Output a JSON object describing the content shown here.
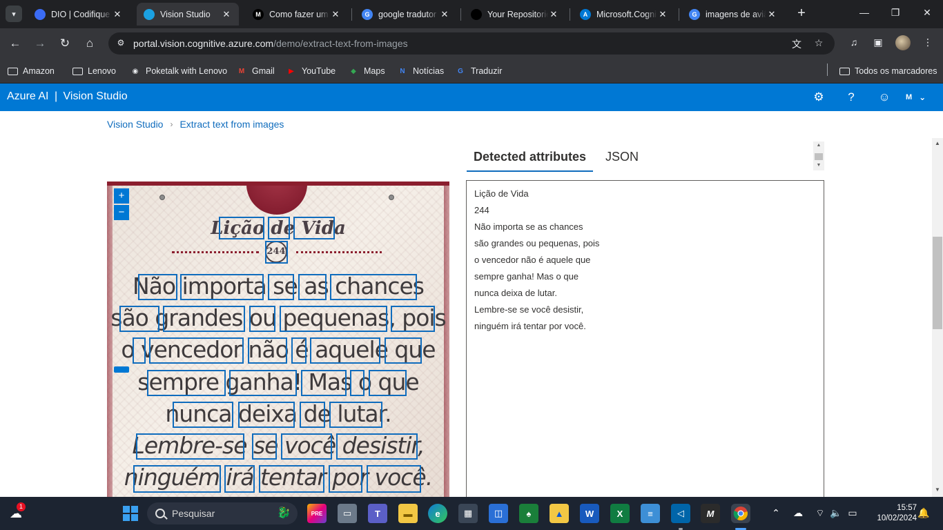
{
  "browser": {
    "tabs": [
      {
        "title": "DIO | Codifique o",
        "color": "#3b6cf5",
        "glyph": "",
        "active": false
      },
      {
        "title": "Vision Studio",
        "color": "#1ba1e2",
        "glyph": "",
        "active": true
      },
      {
        "title": "Como fazer um",
        "color": "#000000",
        "glyph": "M",
        "active": false
      },
      {
        "title": "google tradutor",
        "color": "#4285f4",
        "glyph": "G",
        "active": false
      },
      {
        "title": "Your Repositorie",
        "color": "#000000",
        "glyph": "",
        "active": false
      },
      {
        "title": "Microsoft.Cognit",
        "color": "#0078d4",
        "glyph": "A",
        "active": false
      },
      {
        "title": "imagens de aviã",
        "color": "#4285f4",
        "glyph": "G",
        "active": false
      }
    ],
    "close_glyph": "✕",
    "new_tab_glyph": "+",
    "window_controls": {
      "minimize": "—",
      "restore": "❐",
      "close": "✕"
    },
    "url": {
      "host": "portal.vision.cognitive.azure.com",
      "path": "/demo/extract-text-from-images"
    },
    "bookmarks": [
      {
        "label": "Amazon",
        "icon": "folder-icon"
      },
      {
        "label": "Lenovo",
        "icon": "folder-icon"
      },
      {
        "label": "Poketalk with Lenovo",
        "icon": "poketalk-icon"
      },
      {
        "label": "Gmail",
        "icon": "gmail-icon"
      },
      {
        "label": "YouTube",
        "icon": "youtube-icon"
      },
      {
        "label": "Maps",
        "icon": "maps-icon"
      },
      {
        "label": "Notícias",
        "icon": "news-icon"
      },
      {
        "label": "Traduzir",
        "icon": "translate-icon"
      }
    ],
    "all_bookmarks": "Todos os marcadores"
  },
  "app": {
    "brand": "Azure AI",
    "brand_sep": "|",
    "product": "Vision Studio",
    "user_initial": "M"
  },
  "breadcrumb": {
    "root": "Vision Studio",
    "current": "Extract text from images"
  },
  "result_tabs": {
    "detected": "Detected attributes",
    "json": "JSON"
  },
  "image": {
    "title": "Lição de Vida",
    "number": "244",
    "lines": [
      "Não importa se as chances",
      "são grandes ou pequenas, pois",
      "o vencedor não é aquele que",
      "sempre ganha! Mas o que",
      "nunca deixa de lutar.",
      "Lembre-se se você desistir,",
      "ninguém irá tentar por você."
    ],
    "zoom_in": "+",
    "zoom_out": "−"
  },
  "detected_text": [
    "Lição de Vida",
    "244",
    "Não importa se as chances",
    "são grandes ou pequenas, pois",
    "o vencedor não é aquele que",
    "sempre ganha! Mas o que",
    "nunca deixa de lutar.",
    "Lembre-se se você desistir,",
    "ninguém irá tentar por você."
  ],
  "taskbar": {
    "search_placeholder": "Pesquisar",
    "weather_badge": "1",
    "time": "15:57",
    "date": "10/02/2024"
  },
  "colors": {
    "azure_blue": "#0078d4",
    "chrome_dark": "#202124",
    "chrome_toolbar": "#35363a",
    "bbox_blue": "#0f6cbd",
    "taskbar": "#1c2431"
  }
}
